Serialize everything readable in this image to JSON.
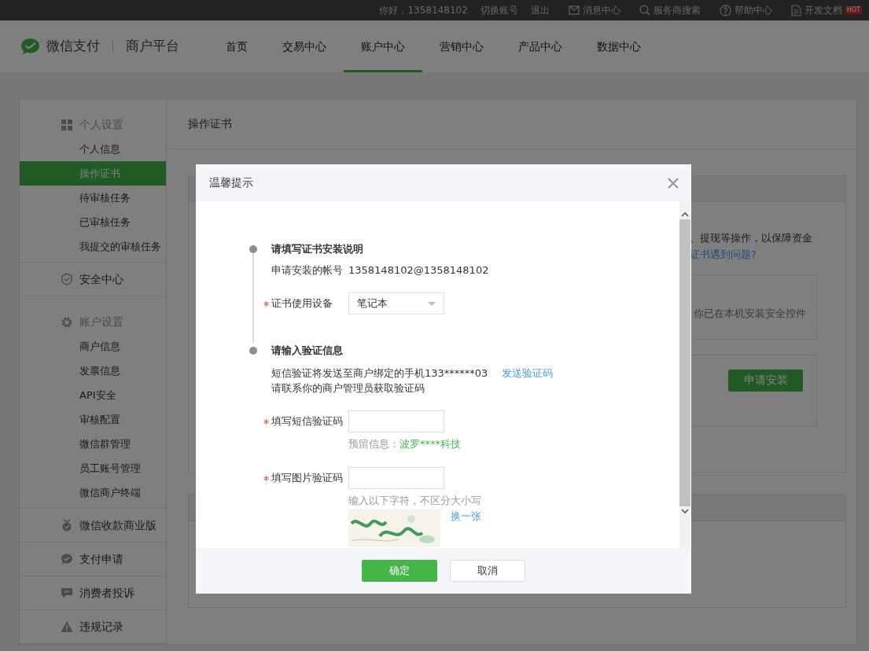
{
  "top_bar": {
    "greeting": "你好，1358148102",
    "links": [
      {
        "label": "切换账号"
      },
      {
        "label": "退出"
      }
    ],
    "tools": [
      {
        "label": "消息中心"
      },
      {
        "label": "服务商搜索"
      },
      {
        "label": "帮助中心"
      },
      {
        "label": "开发文档",
        "badge": "HOT"
      }
    ]
  },
  "header": {
    "brand": "微信支付",
    "product": "商户平台",
    "nav": [
      {
        "label": "首页",
        "selected": false
      },
      {
        "label": "交易中心",
        "selected": false
      },
      {
        "label": "账户中心",
        "selected": true
      },
      {
        "label": "营销中心",
        "selected": false
      },
      {
        "label": "产品中心",
        "selected": false
      },
      {
        "label": "数据中心",
        "selected": false
      }
    ]
  },
  "sidebar": [
    {
      "title": "个人设置",
      "items": [
        {
          "label": "个人信息",
          "selected": false
        },
        {
          "label": "操作证书",
          "selected": true
        },
        {
          "label": "待审核任务",
          "selected": false
        },
        {
          "label": "已审核任务",
          "selected": false
        },
        {
          "label": "我提交的审核任务",
          "selected": false
        }
      ]
    },
    {
      "title": "安全中心"
    },
    {
      "title": "账户设置",
      "items": [
        {
          "label": "商户信息",
          "selected": false
        },
        {
          "label": "发票信息",
          "selected": false
        },
        {
          "label": "API安全",
          "selected": false
        },
        {
          "label": "审核配置",
          "selected": false
        },
        {
          "label": "微信群管理",
          "selected": false
        },
        {
          "label": "员工账号管理",
          "selected": false
        },
        {
          "label": "微信商户终端",
          "selected": false
        }
      ]
    },
    {
      "title": "微信收款商业版"
    },
    {
      "title": "支付申请"
    },
    {
      "title": "消费者投诉"
    },
    {
      "title": "违规记录"
    }
  ],
  "page": {
    "title": "操作证书",
    "notice": "、提现等操作，以保障资金",
    "help_link": "证书遇到问题?",
    "installed_text": "你已在本机安装安全控件",
    "apply_button": "申请安装"
  },
  "dialog": {
    "title": "温馨提示",
    "steps": [
      {
        "title": "请填写证书安装说明",
        "fields": [
          {
            "kind": "info",
            "label": "申请安装的帐号",
            "value": "1358148102@1358148102"
          },
          {
            "kind": "select",
            "label": "证书使用设备",
            "required": true,
            "value": "笔记本"
          }
        ]
      },
      {
        "title": "请输入验证信息",
        "fields": [
          {
            "kind": "note",
            "text": "短信验证将发送至商户绑定的手机133******03",
            "link": "发送验证码"
          },
          {
            "kind": "note",
            "text": "请联系你的商户管理员获取验证码"
          },
          {
            "kind": "input",
            "label": "填写短信验证码",
            "required": true,
            "hint": "预留信息：",
            "hint_value": "波罗****科技"
          },
          {
            "kind": "captcha",
            "label": "填写图片验证码",
            "required": true,
            "hint": "输入以下字符，不区分大小写",
            "refresh": "换一张"
          }
        ]
      }
    ],
    "buttons": [
      {
        "label": "确定",
        "kind": "primary"
      },
      {
        "label": "取消",
        "kind": "default"
      }
    ]
  }
}
